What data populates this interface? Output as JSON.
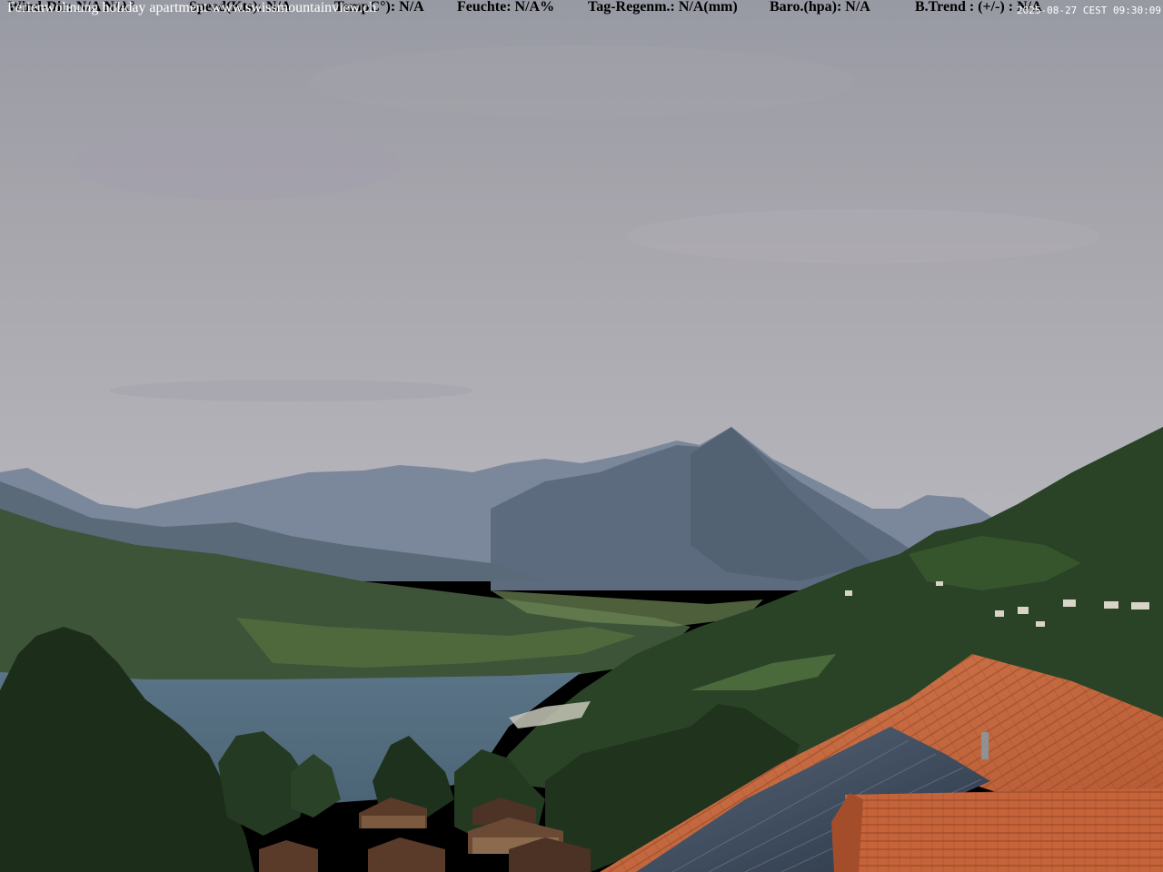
{
  "weather": {
    "wind_dir": "Wind-Dir: N/A  N/A°",
    "speed": "Speed(Kts):   N/A",
    "temp": "TempC°):   N/A",
    "humidity": "Feuchte:  N/A%",
    "rain": "Tag-Regenm.:   N/A(mm)",
    "baro": "Baro.(hpa):   N/A",
    "trend": "B.Trend  : (+/-) : N/A"
  },
  "caption": "Ferienwohnung holiday apartment www.swissmountainview.ch",
  "timestamp": "2025-08-27 CEST 09:30:09",
  "colors": {
    "sky_top": "#9c9ea6",
    "sky_bottom": "#b6b5bb",
    "mountains_far": "#6f7c92",
    "mountains_mid": "#4e5f6c",
    "hills": "#3d5136",
    "lake": "#5b7587",
    "forest": "#1f3520",
    "roof": "#c0633a",
    "solar": "#3c4a5a"
  }
}
